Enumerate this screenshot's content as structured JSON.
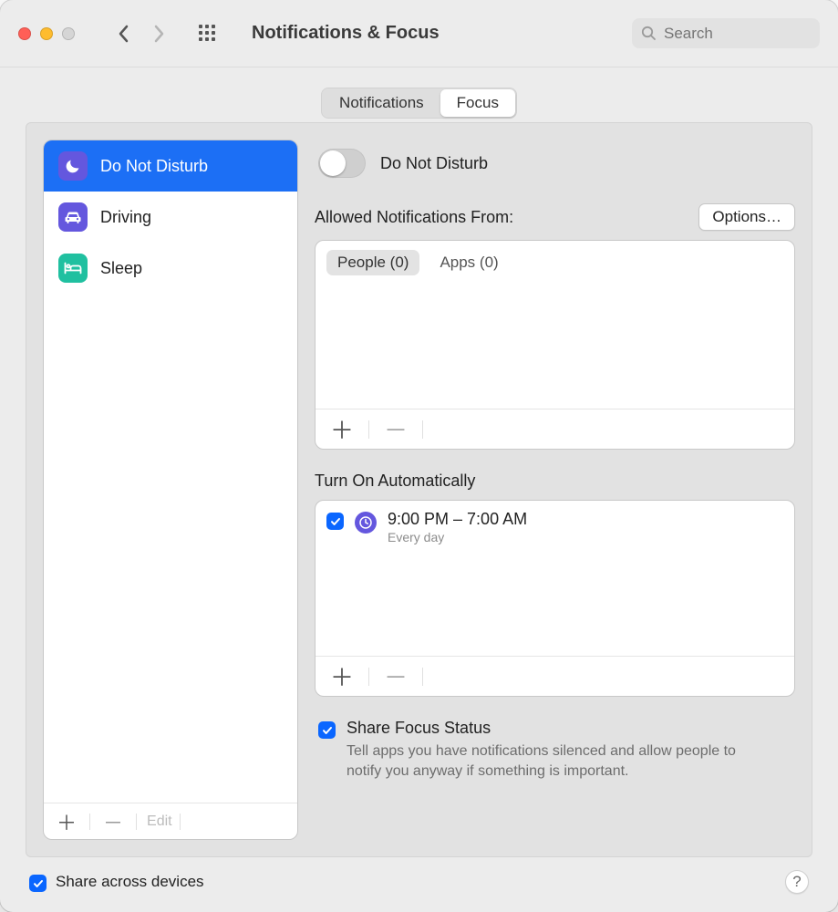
{
  "window": {
    "title": "Notifications & Focus"
  },
  "toolbar": {
    "search_placeholder": "Search"
  },
  "tabs": {
    "notifications": "Notifications",
    "focus": "Focus",
    "active": "focus"
  },
  "sidebar": {
    "items": [
      {
        "id": "dnd",
        "label": "Do Not Disturb",
        "icon": "moon",
        "color": "purple",
        "selected": true
      },
      {
        "id": "driving",
        "label": "Driving",
        "icon": "car",
        "color": "purple",
        "selected": false
      },
      {
        "id": "sleep",
        "label": "Sleep",
        "icon": "bed",
        "color": "teal",
        "selected": false
      }
    ],
    "edit_label": "Edit"
  },
  "focus_panel": {
    "toggle_label": "Do Not Disturb",
    "allowed_title": "Allowed Notifications From:",
    "options_label": "Options…",
    "allowed_tabs": {
      "people": "People (0)",
      "apps": "Apps (0)",
      "active": "people"
    },
    "auto_title": "Turn On Automatically",
    "schedule": {
      "enabled": true,
      "time": "9:00 PM – 7:00 AM",
      "repeat": "Every day"
    },
    "share_status": {
      "checked": true,
      "title": "Share Focus Status",
      "desc": "Tell apps you have notifications silenced and allow people to notify you anyway if something is important."
    }
  },
  "footer": {
    "share_devices": {
      "checked": true,
      "label": "Share across devices"
    }
  }
}
